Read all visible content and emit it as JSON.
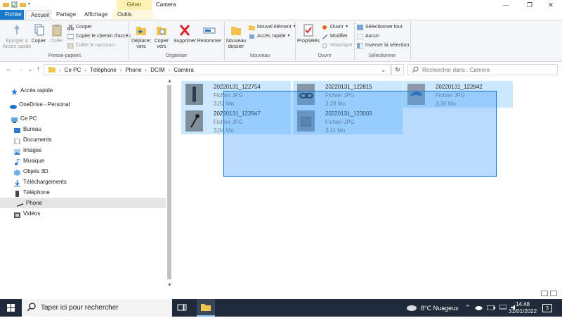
{
  "window": {
    "title": "Camera",
    "context_tab_header": "Gérer",
    "controls": {
      "minimize": "—",
      "maximize": "❐",
      "close": "✕"
    }
  },
  "tabs": [
    "Fichier",
    "Accueil",
    "Partage",
    "Affichage",
    "Outils d'image"
  ],
  "ribbon": {
    "clipboard": {
      "pin": "Épingler à Accès rapide",
      "copy": "Copier",
      "paste": "Coller",
      "cut": "Couper",
      "copy_path": "Copier le chemin d'accès",
      "paste_shortcut": "Coller le raccourci",
      "group": "Presse-papiers"
    },
    "organize": {
      "move_to": "Déplacer vers",
      "copy_to": "Copier vers",
      "delete": "Supprimer",
      "rename": "Renommer",
      "group": "Organiser"
    },
    "new": {
      "new_folder": "Nouveau dossier",
      "new_item": "Nouvel élément",
      "easy_access": "Accès rapide",
      "group": "Nouveau"
    },
    "open": {
      "properties": "Propriétés",
      "open": "Ouvrir",
      "edit": "Modifier",
      "history": "Historique",
      "group": "Ouvrir"
    },
    "select": {
      "select_all": "Sélectionner tout",
      "select_none": "Aucun",
      "invert": "Inverser la sélection",
      "group": "Sélectionner"
    }
  },
  "address": {
    "crumbs": [
      "Ce PC",
      "Téléphone",
      "Phone",
      "DCIM",
      "Camera"
    ],
    "search_placeholder": "Rechercher dans : Camera"
  },
  "nav": [
    {
      "label": "Accès rapide",
      "icon": "star-icon"
    },
    {
      "label": "OneDrive - Personal",
      "icon": "cloud-icon"
    },
    {
      "label": "Ce PC",
      "icon": "computer-icon"
    },
    {
      "label": "Bureau",
      "icon": "desktop-icon"
    },
    {
      "label": "Documents",
      "icon": "documents-icon"
    },
    {
      "label": "Images",
      "icon": "images-icon"
    },
    {
      "label": "Musique",
      "icon": "music-icon"
    },
    {
      "label": "Objets 3D",
      "icon": "cube-icon"
    },
    {
      "label": "Téléchargements",
      "icon": "download-icon"
    },
    {
      "label": "Téléphone",
      "icon": "phone-icon"
    },
    {
      "label": "Phone",
      "icon": "phone-storage-icon"
    },
    {
      "label": "Vidéos",
      "icon": "video-icon"
    }
  ],
  "files": [
    {
      "name": "20220131_122754",
      "type": "Fichier JPG",
      "size": "3,82 Mo"
    },
    {
      "name": "20220131_122815",
      "type": "Fichier JPG",
      "size": "3,28 Mo"
    },
    {
      "name": "20220131_122842",
      "type": "Fichier JPG",
      "size": "3,36 Mo"
    },
    {
      "name": "20220131_122947",
      "type": "Fichier JPG",
      "size": "3,04 Mo"
    },
    {
      "name": "20220131_123003",
      "type": "Fichier JPG",
      "size": "3,11 Mo"
    }
  ],
  "taskbar": {
    "search_placeholder": "Taper ici pour rechercher",
    "weather": "8°C  Nuageux",
    "time": "14:48",
    "date": "31/01/2022",
    "notifications": "3"
  },
  "colors": {
    "accent": "#1979ca",
    "selection": "#cce8ff",
    "taskbar": "#1f2b3a",
    "context_tab": "#fdf0b3"
  }
}
